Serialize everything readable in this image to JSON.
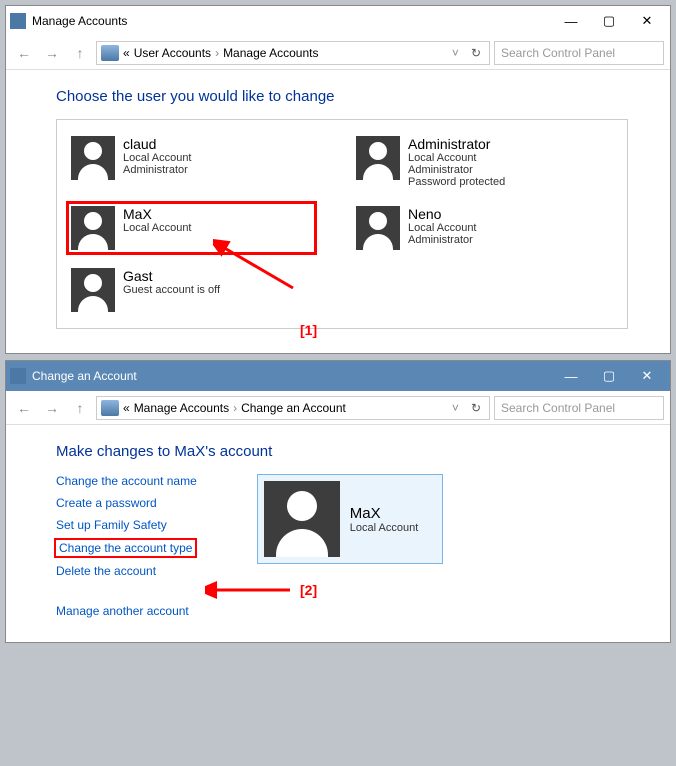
{
  "window1": {
    "title": "Manage Accounts",
    "breadcrumb": [
      "User Accounts",
      "Manage Accounts"
    ],
    "search_placeholder": "Search Control Panel",
    "heading": "Choose the user you would like to change",
    "accounts": [
      {
        "name": "claud",
        "lines": [
          "Local Account",
          "Administrator"
        ]
      },
      {
        "name": "Administrator",
        "lines": [
          "Local Account",
          "Administrator",
          "Password protected"
        ]
      },
      {
        "name": "MaX",
        "lines": [
          "Local Account"
        ],
        "highlight": true
      },
      {
        "name": "Neno",
        "lines": [
          "Local Account",
          "Administrator"
        ]
      },
      {
        "name": "Gast",
        "lines": [
          "Guest account is off"
        ]
      }
    ]
  },
  "window2": {
    "title": "Change an Account",
    "breadcrumb": [
      "Manage Accounts",
      "Change an Account"
    ],
    "search_placeholder": "Search Control Panel",
    "heading": "Make changes to MaX's account",
    "links": [
      {
        "label": "Change the account name"
      },
      {
        "label": "Create a password"
      },
      {
        "label": "Set up Family Safety"
      },
      {
        "label": "Change the account type",
        "highlight": true
      },
      {
        "label": "Delete the account"
      }
    ],
    "secondary_link": "Manage another account",
    "selected_account": {
      "name": "MaX",
      "sub": "Local Account"
    }
  },
  "annotations": {
    "a1": "[1]",
    "a2": "[2]"
  }
}
